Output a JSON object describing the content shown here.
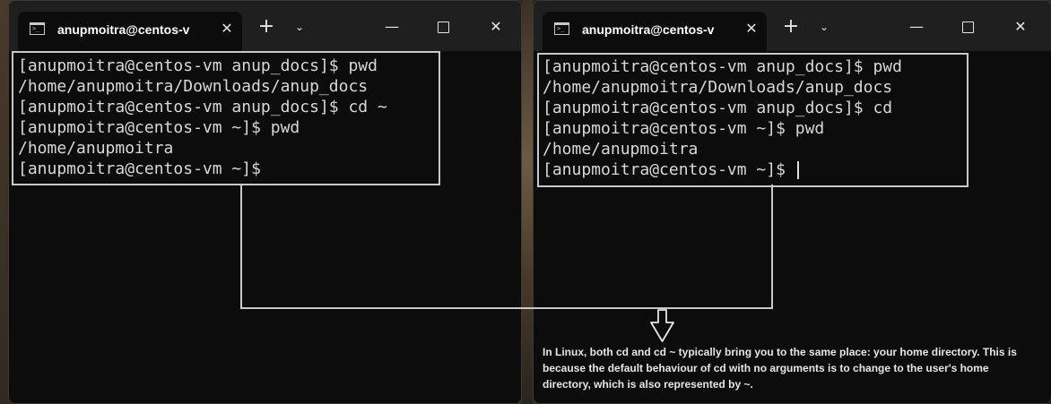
{
  "windows": {
    "left": {
      "tab_title": "anupmoitra@centos-v",
      "lines": [
        "[anupmoitra@centos-vm anup_docs]$ pwd",
        "/home/anupmoitra/Downloads/anup_docs",
        "[anupmoitra@centos-vm anup_docs]$ cd ~",
        "[anupmoitra@centos-vm ~]$ pwd",
        "/home/anupmoitra",
        "[anupmoitra@centos-vm ~]$"
      ]
    },
    "right": {
      "tab_title": "anupmoitra@centos-v",
      "lines": [
        "[anupmoitra@centos-vm anup_docs]$ pwd",
        "/home/anupmoitra/Downloads/anup_docs",
        "[anupmoitra@centos-vm anup_docs]$ cd",
        "[anupmoitra@centos-vm ~]$ pwd",
        "/home/anupmoitra",
        "[anupmoitra@centos-vm ~]$ "
      ],
      "note": "In Linux, both cd and cd ~ typically bring you to the same place: your home directory. This is because the default behaviour of cd with no arguments is to change to the user's home directory, which is also represented by ~."
    }
  },
  "controls": {
    "tab_close": "✕",
    "new_tab": "+",
    "dropdown": "⌄",
    "minimize": "—",
    "close": "✕"
  },
  "icons": {
    "terminal": "terminal-icon",
    "close": "close-icon",
    "plus": "plus-icon",
    "chevron": "chevron-down-icon",
    "minimize": "minimize-icon",
    "maximize": "maximize-icon",
    "arrow": "arrow-down-icon"
  },
  "colors": {
    "terminal_bg": "#0c0c0c",
    "titlebar_bg": "#1f1f1f",
    "text": "#d8d8d8",
    "annotation": "#c8c8c8"
  }
}
